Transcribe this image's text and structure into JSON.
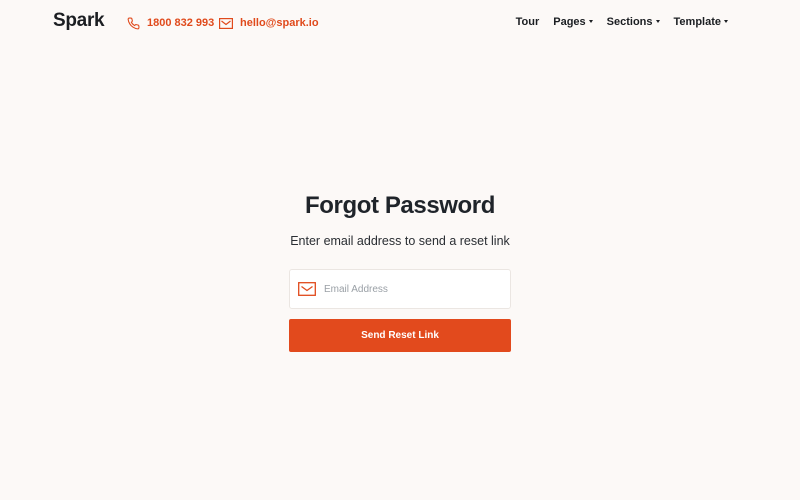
{
  "header": {
    "logo": "Spark",
    "phone": "1800 832 993",
    "email": "hello@spark.io",
    "nav": [
      {
        "label": "Tour",
        "has_dropdown": false
      },
      {
        "label": "Pages",
        "has_dropdown": true
      },
      {
        "label": "Sections",
        "has_dropdown": true
      },
      {
        "label": "Template",
        "has_dropdown": true
      }
    ]
  },
  "form": {
    "title": "Forgot Password",
    "subtitle": "Enter email address to send a reset link",
    "email_placeholder": "Email Address",
    "email_value": "",
    "submit_label": "Send Reset Link"
  },
  "icons": {
    "phone": "phone-icon",
    "email": "envelope-icon",
    "field": "envelope-icon"
  },
  "colors": {
    "accent": "#e24a1d",
    "background": "#fcf9f7",
    "text": "#1f242a"
  }
}
